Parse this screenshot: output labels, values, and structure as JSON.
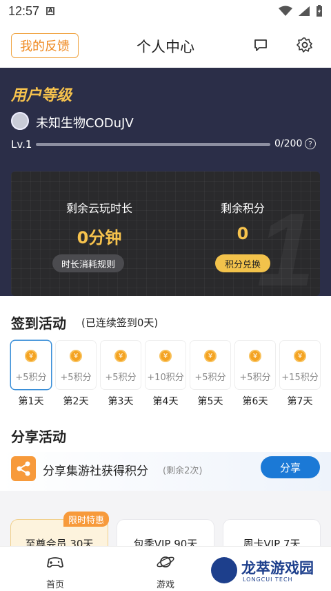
{
  "status_bar": {
    "time": "12:57",
    "notif_glyph": "A"
  },
  "header": {
    "feedback_label": "我的反馈",
    "title": "个人中心",
    "chat_icon": "chat-bubble",
    "settings_icon": "gear"
  },
  "user": {
    "level_title": "用户等级",
    "name": "未知生物CODuJV",
    "level_label": "Lv.1",
    "level_progress": "0/200",
    "level_progress_fraction": 0
  },
  "stats": {
    "time_label": "剩余云玩时长",
    "time_value": "0分钟",
    "time_rule_button": "时长消耗规则",
    "points_label": "剩余积分",
    "points_value": "0",
    "exchange_button": "积分兑换"
  },
  "checkin": {
    "title": "签到活动",
    "subtitle": "(已连续签到0天)",
    "coin_glyph": "¥",
    "days": [
      {
        "points": "+5积分",
        "label": "第1天",
        "active": true
      },
      {
        "points": "+5积分",
        "label": "第2天",
        "active": false
      },
      {
        "points": "+5积分",
        "label": "第3天",
        "active": false
      },
      {
        "points": "+10积分",
        "label": "第4天",
        "active": false
      },
      {
        "points": "+5积分",
        "label": "第5天",
        "active": false
      },
      {
        "points": "+5积分",
        "label": "第6天",
        "active": false
      },
      {
        "points": "+15积分",
        "label": "第7天",
        "active": false
      }
    ]
  },
  "share": {
    "title": "分享活动",
    "text": "分享集游社获得积分",
    "remaining": "(剩余2次)",
    "button": "分享"
  },
  "vip": {
    "tag": "限时特惠",
    "cards": [
      "至尊会员 30天",
      "包季VIP 90天",
      "周卡VIP 7天"
    ]
  },
  "nav": {
    "items": [
      "首页",
      "游戏"
    ]
  },
  "watermark": {
    "title": "龙萃游戏园",
    "sub": "LONGCUI TECH"
  },
  "colors": {
    "accent_gold": "#f7c34d",
    "hero_bg": "#2b2e48",
    "share_blue": "#1b79d6",
    "feedback_orange": "#ef8a22"
  }
}
